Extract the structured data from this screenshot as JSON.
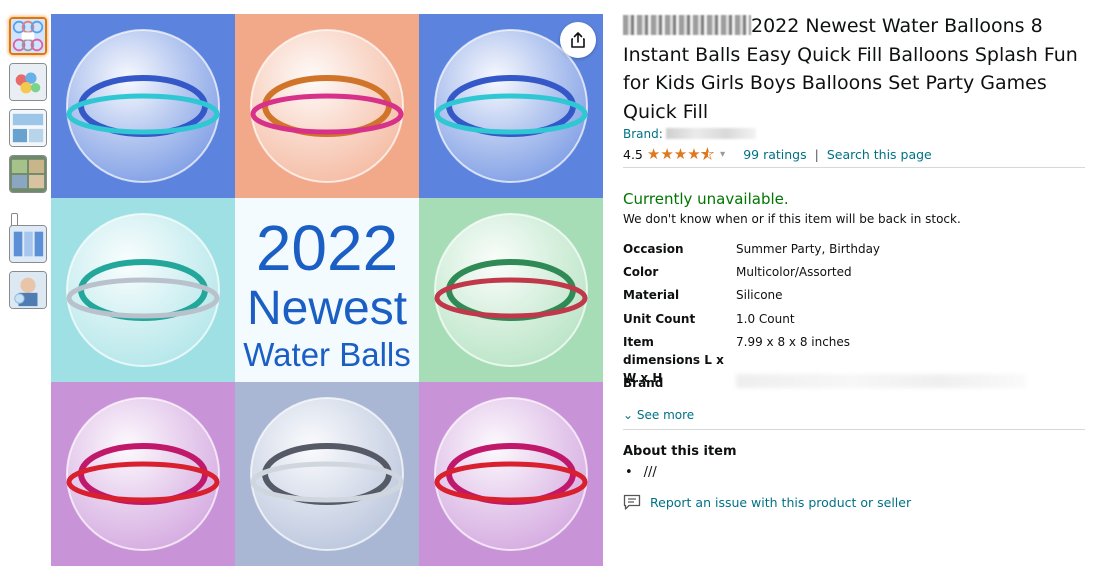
{
  "product": {
    "title_prefix_redacted": "[redacted brand]",
    "title": "2022 Newest Water Balloons 8 Instant Balls Easy Quick Fill Balloons Splash Fun for Kids Girls Boys Balloons Set Party Games Quick Fill",
    "brand_label": "Brand:",
    "rating_value": "4.5",
    "rating_stars": 4.5,
    "ratings_link": "99 ratings",
    "search_link": "Search this page",
    "separator": "|"
  },
  "image": {
    "headline_year": "2022",
    "headline_word": "Newest",
    "headline_sub": "Water Balls"
  },
  "availability": {
    "status": "Currently unavailable.",
    "note": "We don't know when or if this item will be back in stock."
  },
  "specs": [
    {
      "key": "Occasion",
      "value": "Summer Party, Birthday"
    },
    {
      "key": "Color",
      "value": "Multicolor/Assorted"
    },
    {
      "key": "Material",
      "value": "Silicone"
    },
    {
      "key": "Unit Count",
      "value": "1.0 Count"
    },
    {
      "key": "Item dimensions L x W x H",
      "value": "7.99 x 8 x 8 inches"
    },
    {
      "key": "Brand",
      "value": ""
    }
  ],
  "see_more": "See more",
  "about": {
    "title": "About this item",
    "bullets": [
      "///"
    ]
  },
  "report_link": "Report an issue with this product or seller",
  "colors": {
    "link": "#007185",
    "unavailable": "#007600",
    "star": "#de7921",
    "thumb_active_border": "#e77600"
  },
  "icons": [
    "share-icon",
    "chevron-down-icon",
    "star-icon",
    "report-icon",
    "video-thumbnail-icon"
  ]
}
